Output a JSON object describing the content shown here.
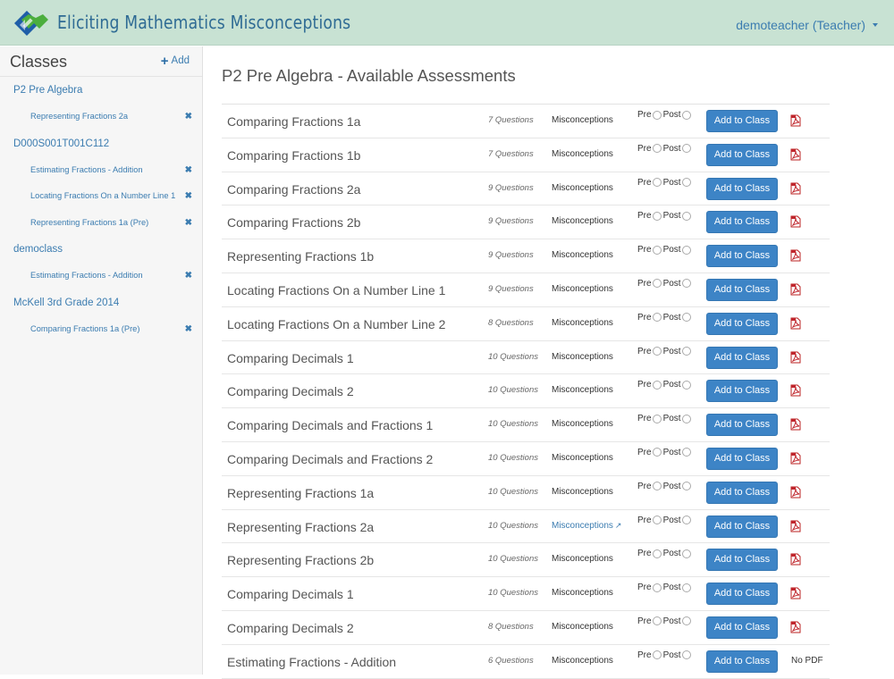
{
  "header": {
    "app_title": "Eliciting Mathematics Misconceptions",
    "user_menu": "demoteacher (Teacher)",
    "logo_icon": "emm-logo",
    "colors": {
      "bar": "#c8e2d3",
      "accent": "#3b7cb0"
    }
  },
  "sidebar": {
    "title": "Classes",
    "add_label": "Add",
    "classes": [
      {
        "name": "P2 Pre Algebra",
        "assessments": [
          "Representing Fractions 2a"
        ]
      },
      {
        "name": "D000S001T001C112",
        "assessments": [
          "Estimating Fractions - Addition",
          "Locating Fractions On a Number Line 1",
          "Representing Fractions 1a (Pre)"
        ]
      },
      {
        "name": "democlass",
        "assessments": [
          "Estimating Fractions - Addition"
        ]
      },
      {
        "name": "McKell 3rd Grade 2014",
        "assessments": [
          "Comparing Fractions 1a (Pre)"
        ]
      }
    ]
  },
  "main": {
    "title": "P2 Pre Algebra - Available Assessments",
    "labels": {
      "pre": "Pre",
      "post": "Post",
      "add_to_class": "Add to Class",
      "no_pdf": "No PDF"
    },
    "assessments": [
      {
        "name": "Comparing Fractions 1a",
        "questions": "7 Questions",
        "misconceptions": "Misconceptions",
        "misc_link": false,
        "pdf": true
      },
      {
        "name": "Comparing Fractions 1b",
        "questions": "7 Questions",
        "misconceptions": "Misconceptions",
        "misc_link": false,
        "pdf": true
      },
      {
        "name": "Comparing Fractions 2a",
        "questions": "9 Questions",
        "misconceptions": "Misconceptions",
        "misc_link": false,
        "pdf": true
      },
      {
        "name": "Comparing Fractions 2b",
        "questions": "9 Questions",
        "misconceptions": "Misconceptions",
        "misc_link": false,
        "pdf": true
      },
      {
        "name": "Representing Fractions 1b",
        "questions": "9 Questions",
        "misconceptions": "Misconceptions",
        "misc_link": false,
        "pdf": true
      },
      {
        "name": "Locating Fractions On a Number Line 1",
        "questions": "9 Questions",
        "misconceptions": "Misconceptions",
        "misc_link": false,
        "pdf": true
      },
      {
        "name": "Locating Fractions On a Number Line 2",
        "questions": "8 Questions",
        "misconceptions": "Misconceptions",
        "misc_link": false,
        "pdf": true
      },
      {
        "name": "Comparing Decimals 1",
        "questions": "10 Questions",
        "misconceptions": "Misconceptions",
        "misc_link": false,
        "pdf": true
      },
      {
        "name": "Comparing Decimals 2",
        "questions": "10 Questions",
        "misconceptions": "Misconceptions",
        "misc_link": false,
        "pdf": true
      },
      {
        "name": "Comparing Decimals and Fractions 1",
        "questions": "10 Questions",
        "misconceptions": "Misconceptions",
        "misc_link": false,
        "pdf": true
      },
      {
        "name": "Comparing Decimals and Fractions 2",
        "questions": "10 Questions",
        "misconceptions": "Misconceptions",
        "misc_link": false,
        "pdf": true
      },
      {
        "name": "Representing Fractions 1a",
        "questions": "10 Questions",
        "misconceptions": "Misconceptions",
        "misc_link": false,
        "pdf": true
      },
      {
        "name": "Representing Fractions 2a",
        "questions": "10 Questions",
        "misconceptions": "Misconceptions",
        "misc_link": true,
        "pdf": true
      },
      {
        "name": "Representing Fractions 2b",
        "questions": "10 Questions",
        "misconceptions": "Misconceptions",
        "misc_link": false,
        "pdf": true
      },
      {
        "name": "Comparing Decimals 1",
        "questions": "10 Questions",
        "misconceptions": "Misconceptions",
        "misc_link": false,
        "pdf": true
      },
      {
        "name": "Comparing Decimals 2",
        "questions": "8 Questions",
        "misconceptions": "Misconceptions",
        "misc_link": false,
        "pdf": true
      },
      {
        "name": "Estimating Fractions - Addition",
        "questions": "6 Questions",
        "misconceptions": "Misconceptions",
        "misc_link": false,
        "pdf": false
      }
    ]
  }
}
